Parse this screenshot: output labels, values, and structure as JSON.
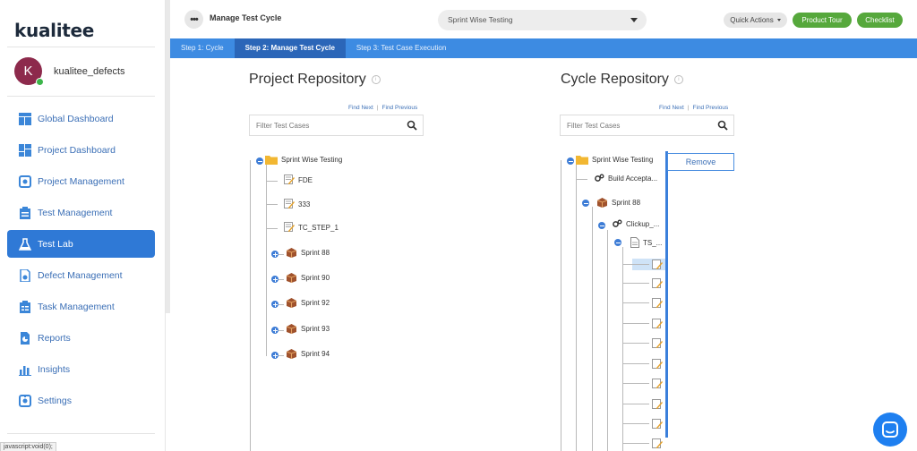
{
  "brand": {
    "logo": "kualitee"
  },
  "user": {
    "initial": "K",
    "name": "kualitee_defects"
  },
  "sidebar": {
    "items": [
      {
        "label": "Global Dashboard",
        "icon": "global-dashboard-icon"
      },
      {
        "label": "Project Dashboard",
        "icon": "project-dashboard-icon"
      },
      {
        "label": "Project Management",
        "icon": "project-management-icon"
      },
      {
        "label": "Test Management",
        "icon": "test-management-icon"
      },
      {
        "label": "Test Lab",
        "icon": "flask-icon",
        "active": true
      },
      {
        "label": "Defect Management",
        "icon": "defect-icon"
      },
      {
        "label": "Task Management",
        "icon": "task-icon"
      },
      {
        "label": "Reports",
        "icon": "reports-icon"
      },
      {
        "label": "Insights",
        "icon": "insights-icon"
      },
      {
        "label": "Settings",
        "icon": "settings-icon"
      }
    ]
  },
  "status_bar": {
    "text": "javascript:void(0);"
  },
  "header": {
    "title": "Manage Test Cycle",
    "cycle_selected": "Sprint Wise Testing",
    "quick_actions": "Quick Actions",
    "product_tour": "Product Tour",
    "checklist": "Checklist"
  },
  "steps": [
    {
      "label": "Step 1: Cycle"
    },
    {
      "label": "Step 2: Manage Test Cycle",
      "active": true
    },
    {
      "label": "Step 3: Test Case Execution"
    }
  ],
  "project_repo": {
    "title": "Project Repository",
    "find_next": "Find Next",
    "find_previous": "Find Previous",
    "filter_placeholder": "Filter Test Cases",
    "root": "Sprint Wise Testing",
    "children": [
      {
        "label": "FDE",
        "type": "testcase"
      },
      {
        "label": "333",
        "type": "testcase"
      },
      {
        "label": "TC_STEP_1",
        "type": "testcase"
      },
      {
        "label": "Sprint 88",
        "type": "sprint"
      },
      {
        "label": "Sprint 90",
        "type": "sprint"
      },
      {
        "label": "Sprint 92",
        "type": "sprint"
      },
      {
        "label": "Sprint 93",
        "type": "sprint"
      },
      {
        "label": "Sprint 94",
        "type": "sprint"
      }
    ]
  },
  "cycle_repo": {
    "title": "Cycle Repository",
    "find_next": "Find Next",
    "find_previous": "Find Previous",
    "filter_placeholder": "Filter Test Cases",
    "root": "Sprint Wise Testing",
    "build": "Build Accepta...",
    "sprint": "Sprint 88",
    "module": "Clickup_...",
    "suite": "TS_...",
    "remove": "Remove"
  },
  "colors": {
    "accent": "#2f79d6",
    "step_bar": "#3d8be2",
    "green": "#56a83c",
    "avatar": "#8d2a4c"
  }
}
